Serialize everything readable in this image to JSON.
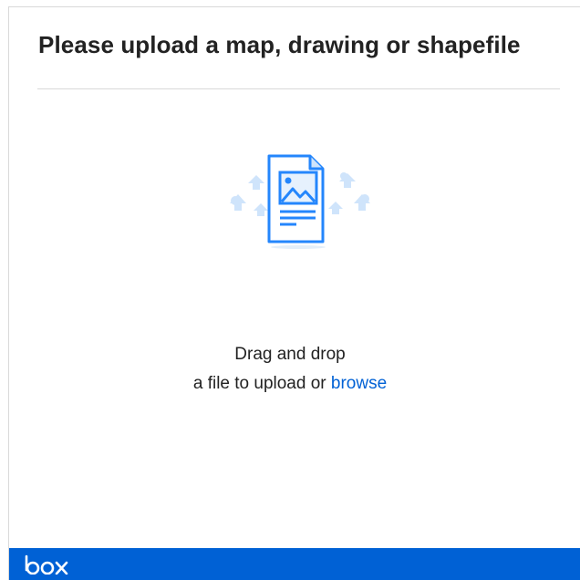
{
  "header": {
    "title": "Please upload a map, drawing or shapefile"
  },
  "dropzone": {
    "line1": "Drag and drop",
    "line2_prefix": "a file to upload or ",
    "browse_label": "browse",
    "icon": "upload-document-icon"
  },
  "footer": {
    "brand": "box",
    "icon": "box-logo"
  },
  "colors": {
    "accent": "#0061d5",
    "illustration": "#2486fc",
    "illustration_light": "#cfe4fb",
    "text": "#222222",
    "divider": "#d8d8d8"
  }
}
